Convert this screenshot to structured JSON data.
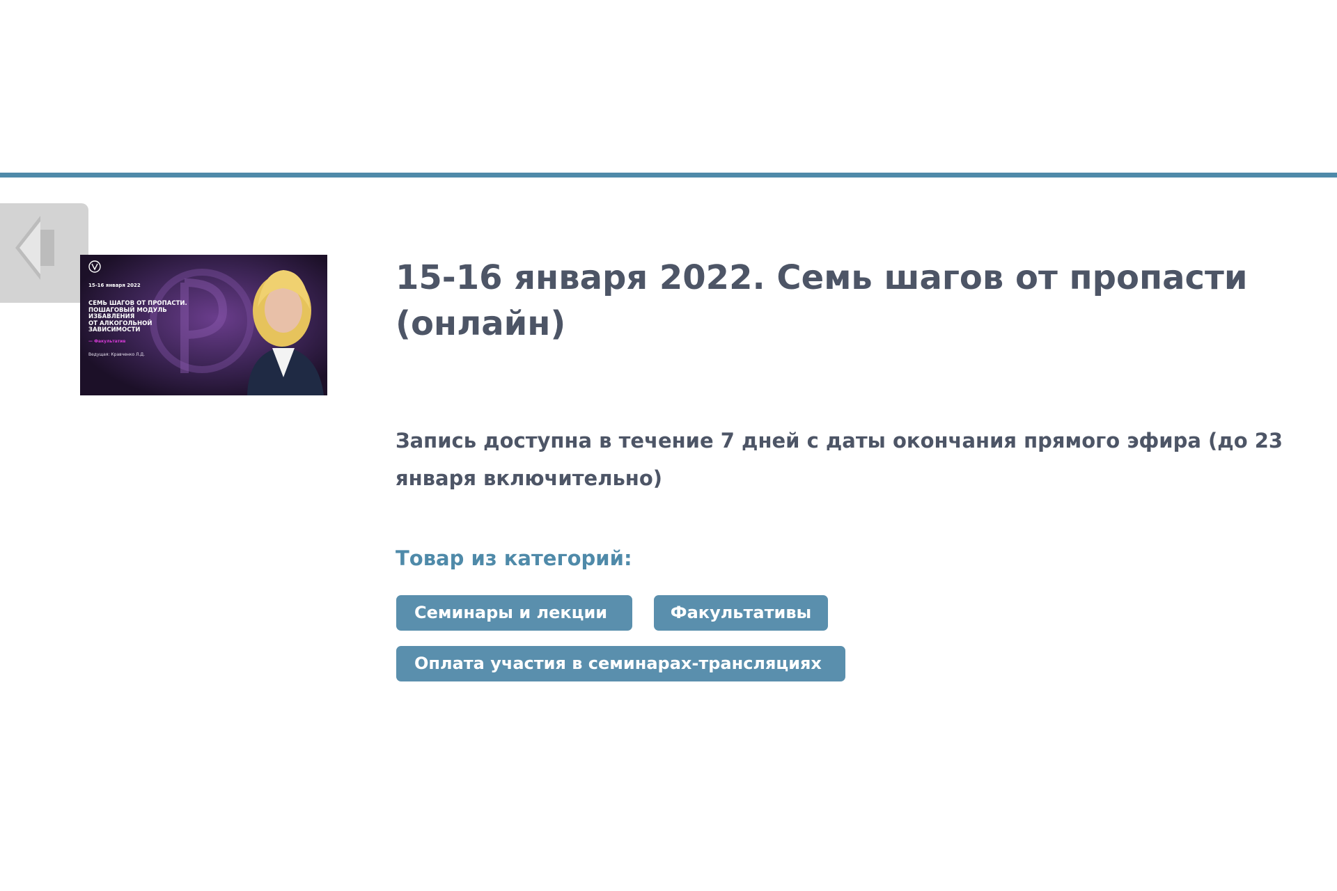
{
  "product": {
    "title": "15-16 января 2022. Семь шагов от пропасти (онлайн)",
    "note": "Запись доступна в течение 7 дней с даты окончания прямого эфира (до 23 января включительно)",
    "categories_label": "Товар из категорий:",
    "categories": [
      "Семинары и лекции",
      "Факультативы",
      "Оплата участия в семинарах-трансляциях"
    ]
  },
  "thumbnail": {
    "date": "15-16 января 2022",
    "title_lines": [
      "Семь шагов от пропасти.",
      "Пошаговый модуль",
      "избавления",
      "от алкогольной",
      "зависимости"
    ],
    "tag": "— Факультатив",
    "host": "Ведущая: Кравченко Л.Д."
  },
  "colors": {
    "accent": "#4f8aa9",
    "chip_bg": "#5a8fad",
    "text": "#4d5566",
    "back_tab": "#d3d3d3",
    "thumbnail_bg": "#241633",
    "thumbnail_tag": "#d63bd6"
  },
  "icons": {
    "back": "arrow-left-icon"
  }
}
